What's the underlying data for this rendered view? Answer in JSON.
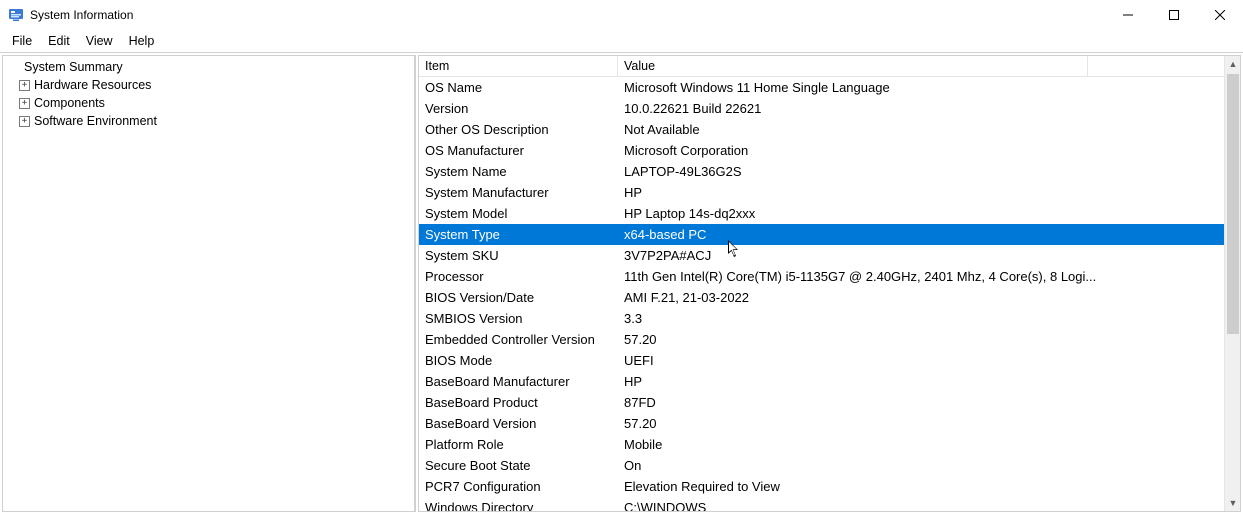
{
  "window": {
    "title": "System Information"
  },
  "menu": {
    "file": "File",
    "edit": "Edit",
    "view": "View",
    "help": "Help"
  },
  "tree": {
    "root": "System Summary",
    "nodes": [
      {
        "label": "Hardware Resources"
      },
      {
        "label": "Components"
      },
      {
        "label": "Software Environment"
      }
    ]
  },
  "columns": {
    "item": "Item",
    "value": "Value"
  },
  "rows": [
    {
      "item": "OS Name",
      "value": "Microsoft Windows 11 Home Single Language"
    },
    {
      "item": "Version",
      "value": "10.0.22621 Build 22621"
    },
    {
      "item": "Other OS Description",
      "value": "Not Available"
    },
    {
      "item": "OS Manufacturer",
      "value": "Microsoft Corporation"
    },
    {
      "item": "System Name",
      "value": "LAPTOP-49L36G2S"
    },
    {
      "item": "System Manufacturer",
      "value": "HP"
    },
    {
      "item": "System Model",
      "value": "HP Laptop 14s-dq2xxx"
    },
    {
      "item": "System Type",
      "value": "x64-based PC",
      "selected": true
    },
    {
      "item": "System SKU",
      "value": "3V7P2PA#ACJ"
    },
    {
      "item": "Processor",
      "value": "11th Gen Intel(R) Core(TM) i5-1135G7 @ 2.40GHz, 2401 Mhz, 4 Core(s), 8 Logi..."
    },
    {
      "item": "BIOS Version/Date",
      "value": "AMI F.21, 21-03-2022"
    },
    {
      "item": "SMBIOS Version",
      "value": "3.3"
    },
    {
      "item": "Embedded Controller Version",
      "value": "57.20"
    },
    {
      "item": "BIOS Mode",
      "value": "UEFI"
    },
    {
      "item": "BaseBoard Manufacturer",
      "value": "HP"
    },
    {
      "item": "BaseBoard Product",
      "value": "87FD"
    },
    {
      "item": "BaseBoard Version",
      "value": "57.20"
    },
    {
      "item": "Platform Role",
      "value": "Mobile"
    },
    {
      "item": "Secure Boot State",
      "value": "On"
    },
    {
      "item": "PCR7 Configuration",
      "value": "Elevation Required to View"
    },
    {
      "item": "Windows Directory",
      "value": "C:\\WINDOWS"
    }
  ]
}
